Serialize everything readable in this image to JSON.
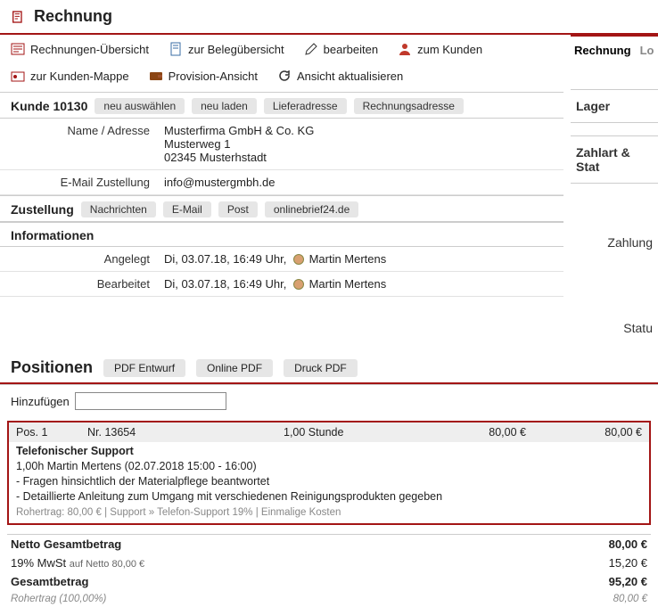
{
  "title": "Rechnung",
  "toolbar": {
    "overview": "Rechnungen-Übersicht",
    "beleg": "zur Belegübersicht",
    "bearbeiten": "bearbeiten",
    "kunden": "zum Kunden",
    "mappe": "zur Kunden-Mappe",
    "provision": "Provision-Ansicht",
    "refresh": "Ansicht aktualisieren"
  },
  "customer": {
    "headerPrefix": "Kunde",
    "number": "10130",
    "chips": {
      "neuAuswahl": "neu auswählen",
      "neuLaden": "neu laden",
      "liefer": "Lieferadresse",
      "rechnung": "Rechnungsadresse"
    },
    "nameLabel": "Name / Adresse",
    "name": "Musterfirma GmbH & Co. KG",
    "street": "Musterweg 1",
    "city": "02345 Musterhstadt",
    "emailLabel": "E-Mail Zustellung",
    "email": "info@mustergmbh.de"
  },
  "delivery": {
    "header": "Zustellung",
    "chips": {
      "nachrichten": "Nachrichten",
      "email": "E-Mail",
      "post": "Post",
      "onlinebrief": "onlinebrief24.de"
    }
  },
  "info": {
    "header": "Informationen",
    "angelegtLabel": "Angelegt",
    "angelegtValue": "Di, 03.07.18, 16:49 Uhr,",
    "angelegtBy": "Martin Mertens",
    "bearbLabel": "Bearbeitet",
    "bearbValue": "Di, 03.07.18, 16:49 Uhr,",
    "bearbBy": "Martin Mertens"
  },
  "side": {
    "tab1": "Rechnung",
    "tab2": "Lo",
    "lager": "Lager",
    "zahlart": "Zahlart & Stat",
    "zahlung": "Zahlung",
    "status": "Statu"
  },
  "positions": {
    "header": "Positionen",
    "pdfEntwurf": "PDF Entwurf",
    "onlinePdf": "Online PDF",
    "druckPdf": "Druck PDF",
    "addLabel": "Hinzufügen",
    "row": {
      "pos": "Pos. 1",
      "nr": "Nr. 13654",
      "qty": "1,00 Stunde",
      "price": "80,00 €",
      "total": "80,00 €",
      "title": "Telefonischer Support",
      "line1": "1,00h Martin Mertens (02.07.2018 15:00 - 16:00)",
      "line2": "- Fragen hinsichtlich der Materialpflege beantwortet",
      "line3": "- Detaillierte Anleitung zum Umgang mit verschiedenen Reinigungsprodukten gegeben",
      "meta": "Rohertrag: 80,00 € | Support » Telefon-Support 19% | Einmalige Kosten"
    }
  },
  "totals": {
    "nettoLabel": "Netto Gesamtbetrag",
    "netto": "80,00 €",
    "mwstLabel": "19% MwSt",
    "mwstSub": "auf Netto 80,00 €",
    "mwst": "15,20 €",
    "gesamtLabel": "Gesamtbetrag",
    "gesamt": "95,20 €",
    "rohLabel": "Rohertrag (100,00%)",
    "roh": "80,00 €"
  }
}
